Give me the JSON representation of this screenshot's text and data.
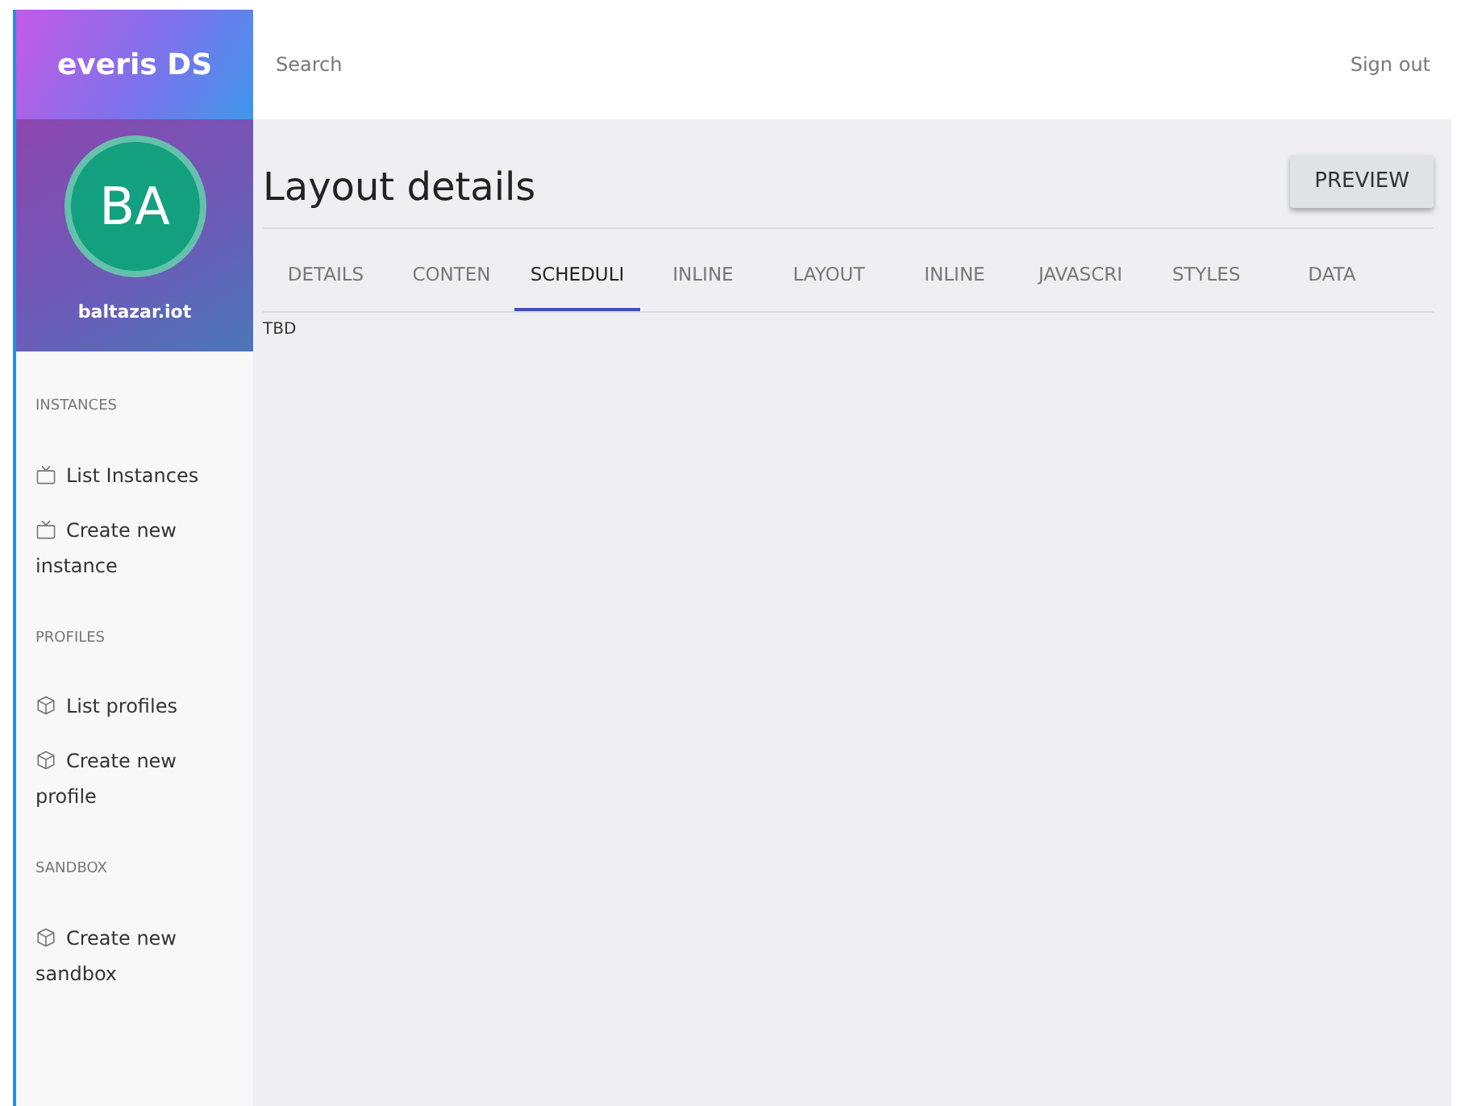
{
  "brand": "everis DS",
  "user": {
    "initials": "BA",
    "name": "baltazar.iot"
  },
  "topbar": {
    "search": {
      "placeholder": "Search"
    },
    "signout": "Sign out"
  },
  "sidebar": {
    "sections": [
      {
        "title": "INSTANCES",
        "items": [
          {
            "label": "List Instances",
            "kind": "tv"
          },
          {
            "label": "Create new instance",
            "kind": "tv"
          }
        ]
      },
      {
        "title": "PROFILES",
        "items": [
          {
            "label": "List profiles",
            "kind": "box"
          },
          {
            "label": "Create new profile",
            "kind": "box"
          }
        ]
      },
      {
        "title": "SANDBOX",
        "items": [
          {
            "label": "Create new sandbox",
            "kind": "box"
          }
        ]
      }
    ]
  },
  "page": {
    "title": "Layout details",
    "button": "PREVIEW"
  },
  "tabs": [
    {
      "label": "DETAILS",
      "selected": false
    },
    {
      "label": "CONTEN",
      "selected": false
    },
    {
      "label": "SCHEDULI",
      "selected": true
    },
    {
      "label": "INLINE",
      "selected": false
    },
    {
      "label": "LAYOUT",
      "selected": false
    },
    {
      "label": "INLINE",
      "selected": false
    },
    {
      "label": "JAVASCRI",
      "selected": false
    },
    {
      "label": "STYLES",
      "selected": false
    },
    {
      "label": "DATA",
      "selected": false
    }
  ],
  "content": "TBD"
}
